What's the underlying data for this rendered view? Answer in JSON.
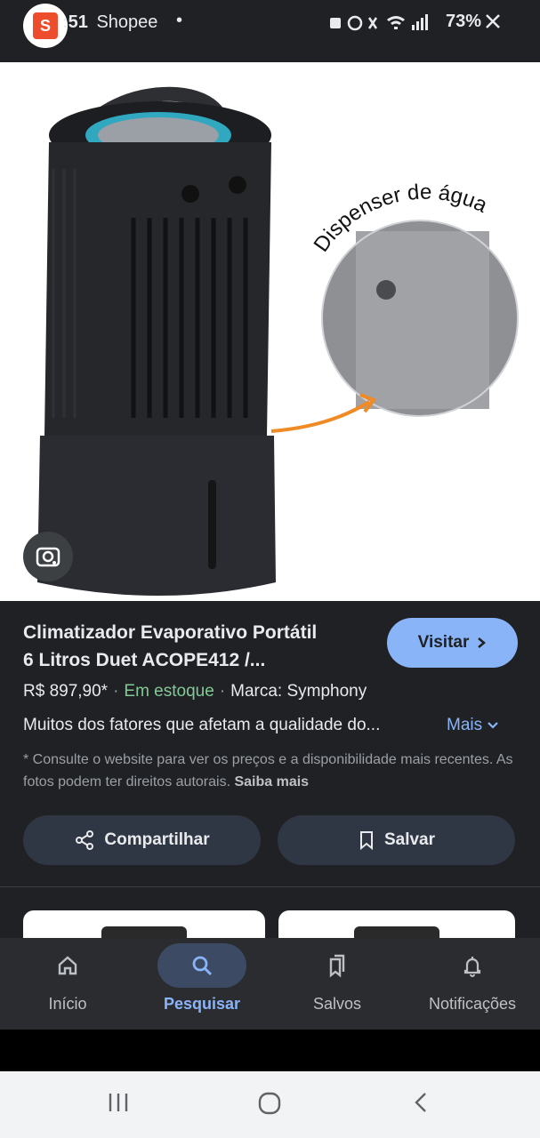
{
  "status_bar": {
    "app_name": "Shopee",
    "time": ":51",
    "battery": "73%",
    "notification_dot": "•"
  },
  "image": {
    "callout_text": "Dispenser de água",
    "accent_color": "#f08a24"
  },
  "product": {
    "title_line1": "Climatizador Evaporativo Portátil",
    "title_line2": "6 Litros Duet ACOPE412 /...",
    "visit_label": "Visitar",
    "price": "R$ 897,90*",
    "stock": "Em estoque",
    "brand": "Marca: Symphony",
    "description": "Muitos dos fatores que afetam a qualidade do...",
    "more_label": "Mais",
    "disclaimer": "* Consulte o website para ver os preços e a disponibilidade mais recentes. As fotos podem ter direitos autorais.",
    "learn_more": "Saiba mais",
    "share_label": "Compartilhar",
    "save_label": "Salvar"
  },
  "bottom_nav": {
    "items": [
      {
        "label": "Início",
        "icon": "home-icon"
      },
      {
        "label": "Pesquisar",
        "icon": "search-icon",
        "active": true
      },
      {
        "label": "Salvos",
        "icon": "saved-icon"
      },
      {
        "label": "Notificações",
        "icon": "bell-icon"
      }
    ]
  },
  "colors": {
    "accent_blue": "#8ab4f8",
    "in_stock_green": "#81c995",
    "background": "#202124"
  }
}
